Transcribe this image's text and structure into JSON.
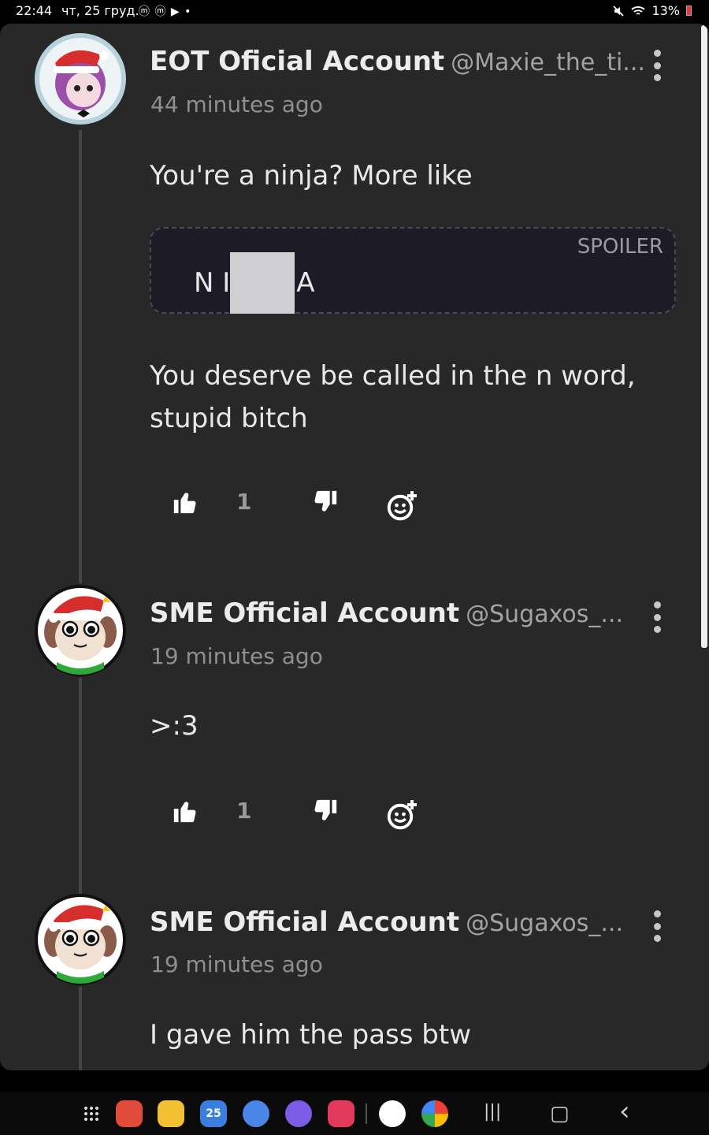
{
  "status_bar": {
    "time": "22:44",
    "date": "чт, 25 груд.",
    "notifications": "ⓜ ⓜ ▶ •",
    "battery": "13%"
  },
  "comments": [
    {
      "author": "EOT Oficial Account",
      "handle": "@Maxie_the_ti...",
      "time": "44 minutes ago",
      "text": "You're a ninja? More like",
      "spoiler_label": "SPOILER",
      "spoiler_left": "N I",
      "spoiler_right": "A",
      "text2": "You deserve be called in the n word, stupid bitch",
      "likes": "1"
    },
    {
      "author": "SME Official Account",
      "handle": "@Sugaxos_...",
      "time": "19 minutes ago",
      "text": ">:3",
      "likes": "1"
    },
    {
      "author": "SME Official Account",
      "handle": "@Sugaxos_...",
      "time": "19 minutes ago",
      "text": "I gave him the pass btw"
    }
  ],
  "nav": {
    "recents_glyph": "|||",
    "home_glyph": "▢",
    "back_glyph": "‹"
  },
  "dock": {
    "calendar_day": "25"
  },
  "colors": {
    "panel_bg": "#282828",
    "spoiler_bg": "#1c1b26",
    "text_primary": "#e8e8e8",
    "text_muted": "#8f8f8f"
  }
}
